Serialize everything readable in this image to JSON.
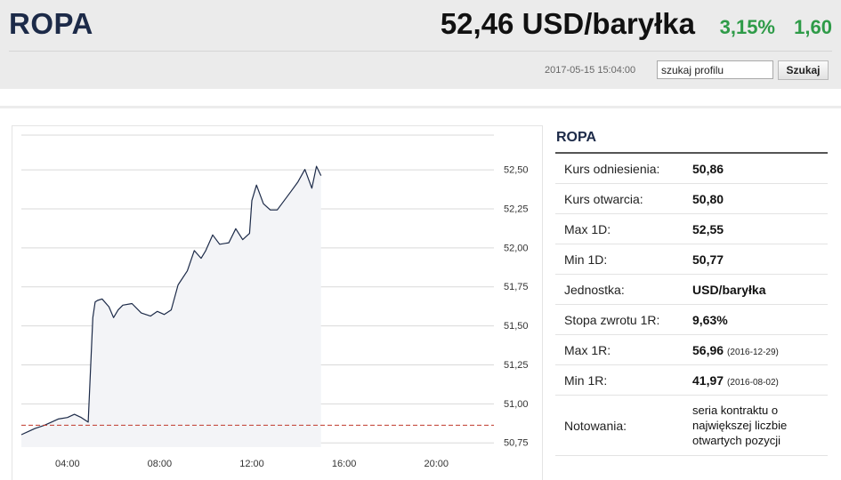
{
  "header": {
    "title": "ROPA",
    "price": "52,46 USD/baryłka",
    "change_pct": "3,15%",
    "change_abs": "1,60",
    "timestamp": "2017-05-15 15:04:00",
    "search_value": "szukaj profilu",
    "search_button": "Szukaj"
  },
  "colors": {
    "title": "#1c2a48",
    "positive": "#2e9b48",
    "line": "#1c2a48",
    "reference": "#c0392b"
  },
  "info": {
    "title": "ROPA",
    "rows": [
      {
        "label": "Kurs odniesienia:",
        "value": "50,86"
      },
      {
        "label": "Kurs otwarcia:",
        "value": "50,80"
      },
      {
        "label": "Max 1D:",
        "value": "52,55"
      },
      {
        "label": "Min 1D:",
        "value": "50,77"
      },
      {
        "label": "Jednostka:",
        "value": "USD/baryłka"
      },
      {
        "label": "Stopa zwrotu 1R:",
        "value": "9,63%"
      },
      {
        "label": "Max 1R:",
        "value": "56,96",
        "date": "(2016-12-29)"
      },
      {
        "label": "Min 1R:",
        "value": "41,97",
        "date": "(2016-08-02)"
      },
      {
        "label": "Notowania:",
        "value": "seria kontraktu o największej liczbie otwartych pozycji"
      }
    ]
  },
  "chart_data": {
    "type": "line",
    "x_ticks": [
      "04:00",
      "08:00",
      "12:00",
      "16:00",
      "20:00"
    ],
    "y_ticks": [
      "52,50",
      "52,25",
      "52,00",
      "51,75",
      "51,50",
      "51,25",
      "51,00",
      "50,75"
    ],
    "ylim": [
      50.72,
      52.72
    ],
    "xlim_hours": [
      2.0,
      22.5
    ],
    "reference_value": 50.86,
    "grid": "horizontal",
    "series": [
      {
        "x": [
          2.0,
          2.3,
          2.6,
          3.0,
          3.3,
          3.6,
          4.0,
          4.3,
          4.6,
          4.9,
          5.1,
          5.2,
          5.3,
          5.5,
          5.8,
          6.0,
          6.2,
          6.4,
          6.8,
          7.2,
          7.6,
          7.9,
          8.2,
          8.5,
          8.8,
          9.2,
          9.5,
          9.8,
          10.0,
          10.3,
          10.6,
          11.0,
          11.3,
          11.6,
          11.9,
          12.0,
          12.2,
          12.5,
          12.8,
          13.1,
          13.4,
          13.7,
          14.0,
          14.3,
          14.6,
          14.8,
          15.0
        ],
        "y": [
          50.8,
          50.82,
          50.84,
          50.86,
          50.88,
          50.9,
          50.91,
          50.93,
          50.91,
          50.88,
          51.55,
          51.65,
          51.66,
          51.67,
          51.62,
          51.55,
          51.6,
          51.63,
          51.64,
          51.58,
          51.56,
          51.59,
          51.57,
          51.6,
          51.76,
          51.85,
          51.98,
          51.93,
          51.98,
          52.08,
          52.02,
          52.03,
          52.12,
          52.05,
          52.09,
          52.3,
          52.4,
          52.28,
          52.24,
          52.24,
          52.3,
          52.36,
          52.42,
          52.5,
          52.38,
          52.52,
          52.46
        ]
      }
    ]
  }
}
